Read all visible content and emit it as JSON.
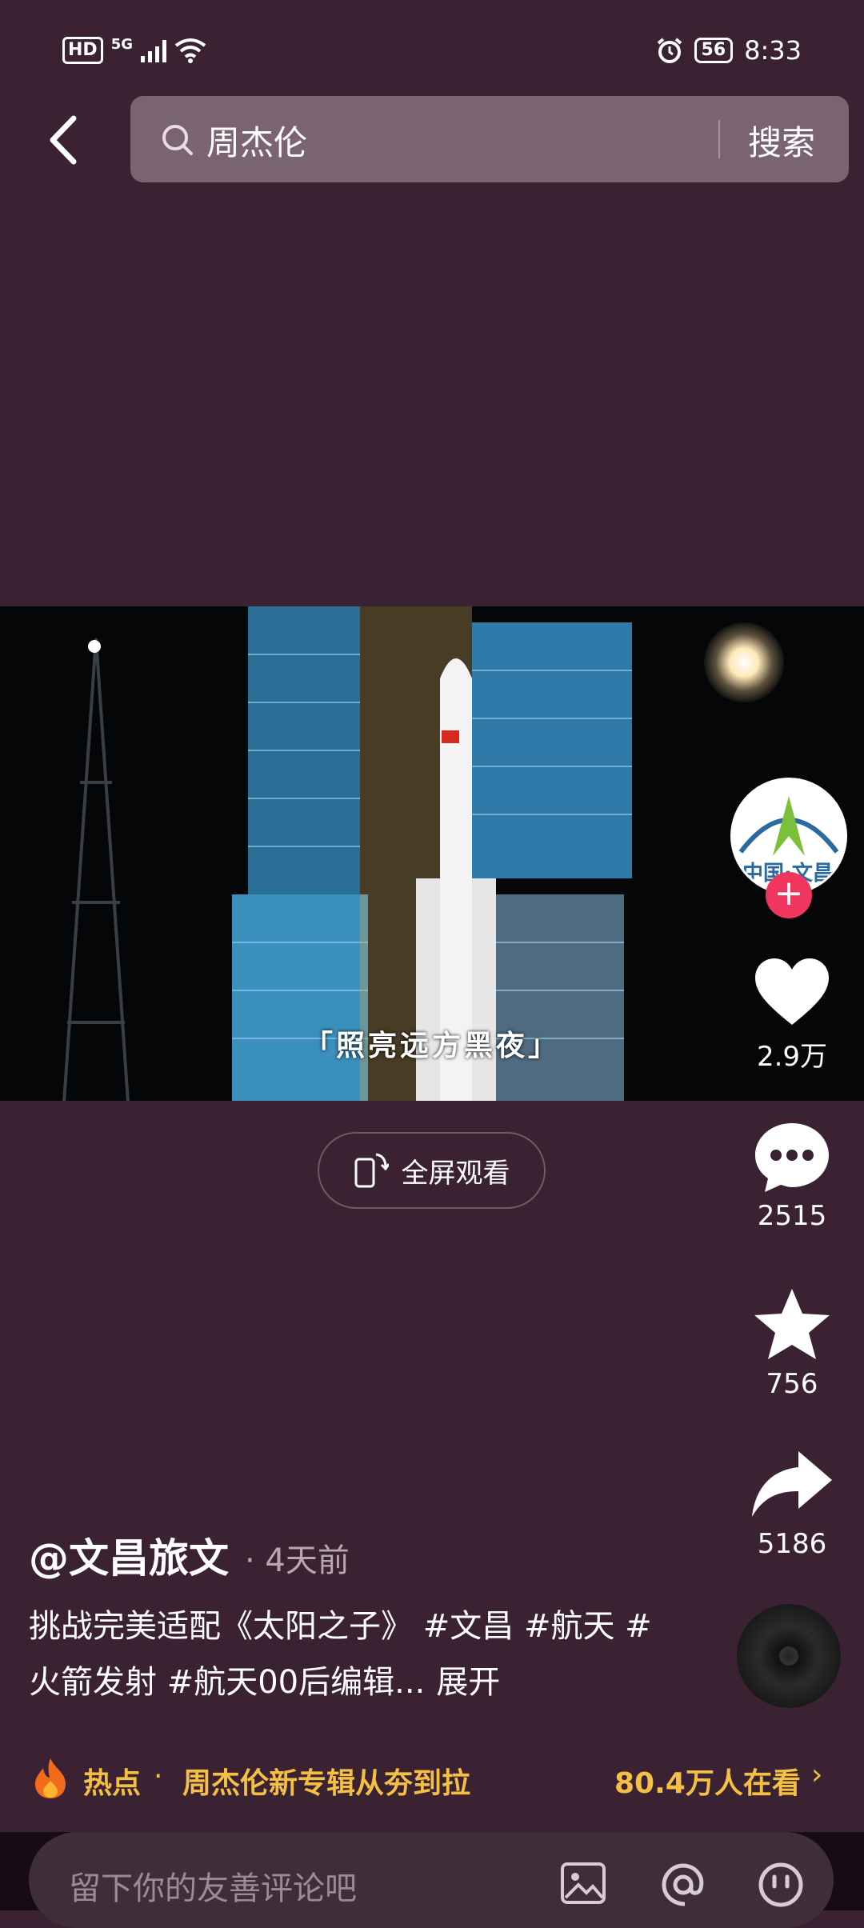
{
  "status_bar": {
    "hd": "HD",
    "network": "5G",
    "battery": "56",
    "time": "8:33"
  },
  "search": {
    "query": "周杰伦",
    "button_label": "搜索"
  },
  "video": {
    "caption": "「照亮远方黑夜」"
  },
  "fullscreen": {
    "label": "全屏观看"
  },
  "sidebar": {
    "avatar_text": "中国·文昌",
    "like_count": "2.9万",
    "comment_count": "2515",
    "favorite_count": "756",
    "share_count": "5186"
  },
  "post": {
    "author": "@文昌旅文",
    "time": "· 4天前",
    "description": "挑战完美适配《太阳之子》 #文昌 #航天 #火箭发射 #航天00后编辑...",
    "expand_label": "展开"
  },
  "hot": {
    "label": "热点",
    "separator": "·",
    "topic": "周杰伦新专辑从夯到拉",
    "watching": "80.4万人在看"
  },
  "comment": {
    "placeholder": "留下你的友善评论吧"
  },
  "colors": {
    "background": "#3a2232",
    "accent_hot": "#f4c043",
    "follow": "#f0355e"
  }
}
